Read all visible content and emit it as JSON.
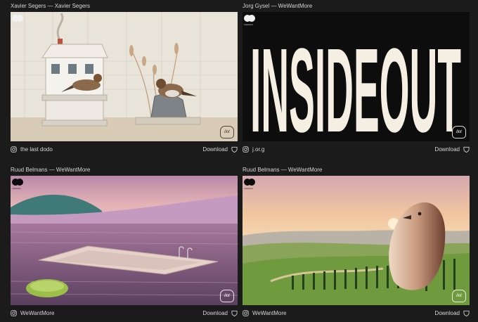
{
  "cards": [
    {
      "author": "Xavier Segers — Xavier Segers",
      "handle": "the last dodo",
      "download": "Download",
      "badge": "InsideOut",
      "watermark": "ilot"
    },
    {
      "author": "Jorg Gysel — WeWantMore",
      "handle": "j.or.g",
      "download": "Download",
      "badge": "InsideOut",
      "watermark": "ilot",
      "artwork_text": "INSIDEOUT"
    },
    {
      "author": "Ruud Belmans — WeWantMore",
      "handle": "WeWantMore",
      "download": "Download",
      "badge": "InsideOut",
      "watermark": "ilot"
    },
    {
      "author": "Ruud Belmans — WeWantMore",
      "handle": "WeWantMore",
      "download": "Download",
      "badge": "InsideOut",
      "watermark": "ilot"
    }
  ],
  "icons": {
    "handle": "instagram-icon",
    "download": "heart-shield-icon"
  }
}
